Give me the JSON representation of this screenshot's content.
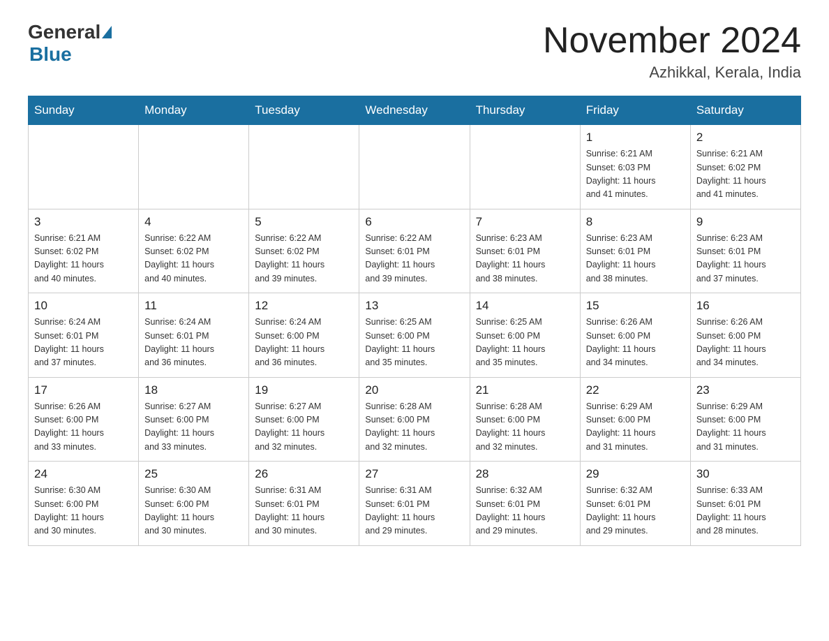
{
  "header": {
    "logo_general": "General",
    "logo_blue": "Blue",
    "month_title": "November 2024",
    "location": "Azhikkal, Kerala, India"
  },
  "weekdays": [
    "Sunday",
    "Monday",
    "Tuesday",
    "Wednesday",
    "Thursday",
    "Friday",
    "Saturday"
  ],
  "weeks": [
    [
      {
        "day": "",
        "info": ""
      },
      {
        "day": "",
        "info": ""
      },
      {
        "day": "",
        "info": ""
      },
      {
        "day": "",
        "info": ""
      },
      {
        "day": "",
        "info": ""
      },
      {
        "day": "1",
        "info": "Sunrise: 6:21 AM\nSunset: 6:03 PM\nDaylight: 11 hours\nand 41 minutes."
      },
      {
        "day": "2",
        "info": "Sunrise: 6:21 AM\nSunset: 6:02 PM\nDaylight: 11 hours\nand 41 minutes."
      }
    ],
    [
      {
        "day": "3",
        "info": "Sunrise: 6:21 AM\nSunset: 6:02 PM\nDaylight: 11 hours\nand 40 minutes."
      },
      {
        "day": "4",
        "info": "Sunrise: 6:22 AM\nSunset: 6:02 PM\nDaylight: 11 hours\nand 40 minutes."
      },
      {
        "day": "5",
        "info": "Sunrise: 6:22 AM\nSunset: 6:02 PM\nDaylight: 11 hours\nand 39 minutes."
      },
      {
        "day": "6",
        "info": "Sunrise: 6:22 AM\nSunset: 6:01 PM\nDaylight: 11 hours\nand 39 minutes."
      },
      {
        "day": "7",
        "info": "Sunrise: 6:23 AM\nSunset: 6:01 PM\nDaylight: 11 hours\nand 38 minutes."
      },
      {
        "day": "8",
        "info": "Sunrise: 6:23 AM\nSunset: 6:01 PM\nDaylight: 11 hours\nand 38 minutes."
      },
      {
        "day": "9",
        "info": "Sunrise: 6:23 AM\nSunset: 6:01 PM\nDaylight: 11 hours\nand 37 minutes."
      }
    ],
    [
      {
        "day": "10",
        "info": "Sunrise: 6:24 AM\nSunset: 6:01 PM\nDaylight: 11 hours\nand 37 minutes."
      },
      {
        "day": "11",
        "info": "Sunrise: 6:24 AM\nSunset: 6:01 PM\nDaylight: 11 hours\nand 36 minutes."
      },
      {
        "day": "12",
        "info": "Sunrise: 6:24 AM\nSunset: 6:00 PM\nDaylight: 11 hours\nand 36 minutes."
      },
      {
        "day": "13",
        "info": "Sunrise: 6:25 AM\nSunset: 6:00 PM\nDaylight: 11 hours\nand 35 minutes."
      },
      {
        "day": "14",
        "info": "Sunrise: 6:25 AM\nSunset: 6:00 PM\nDaylight: 11 hours\nand 35 minutes."
      },
      {
        "day": "15",
        "info": "Sunrise: 6:26 AM\nSunset: 6:00 PM\nDaylight: 11 hours\nand 34 minutes."
      },
      {
        "day": "16",
        "info": "Sunrise: 6:26 AM\nSunset: 6:00 PM\nDaylight: 11 hours\nand 34 minutes."
      }
    ],
    [
      {
        "day": "17",
        "info": "Sunrise: 6:26 AM\nSunset: 6:00 PM\nDaylight: 11 hours\nand 33 minutes."
      },
      {
        "day": "18",
        "info": "Sunrise: 6:27 AM\nSunset: 6:00 PM\nDaylight: 11 hours\nand 33 minutes."
      },
      {
        "day": "19",
        "info": "Sunrise: 6:27 AM\nSunset: 6:00 PM\nDaylight: 11 hours\nand 32 minutes."
      },
      {
        "day": "20",
        "info": "Sunrise: 6:28 AM\nSunset: 6:00 PM\nDaylight: 11 hours\nand 32 minutes."
      },
      {
        "day": "21",
        "info": "Sunrise: 6:28 AM\nSunset: 6:00 PM\nDaylight: 11 hours\nand 32 minutes."
      },
      {
        "day": "22",
        "info": "Sunrise: 6:29 AM\nSunset: 6:00 PM\nDaylight: 11 hours\nand 31 minutes."
      },
      {
        "day": "23",
        "info": "Sunrise: 6:29 AM\nSunset: 6:00 PM\nDaylight: 11 hours\nand 31 minutes."
      }
    ],
    [
      {
        "day": "24",
        "info": "Sunrise: 6:30 AM\nSunset: 6:00 PM\nDaylight: 11 hours\nand 30 minutes."
      },
      {
        "day": "25",
        "info": "Sunrise: 6:30 AM\nSunset: 6:00 PM\nDaylight: 11 hours\nand 30 minutes."
      },
      {
        "day": "26",
        "info": "Sunrise: 6:31 AM\nSunset: 6:01 PM\nDaylight: 11 hours\nand 30 minutes."
      },
      {
        "day": "27",
        "info": "Sunrise: 6:31 AM\nSunset: 6:01 PM\nDaylight: 11 hours\nand 29 minutes."
      },
      {
        "day": "28",
        "info": "Sunrise: 6:32 AM\nSunset: 6:01 PM\nDaylight: 11 hours\nand 29 minutes."
      },
      {
        "day": "29",
        "info": "Sunrise: 6:32 AM\nSunset: 6:01 PM\nDaylight: 11 hours\nand 29 minutes."
      },
      {
        "day": "30",
        "info": "Sunrise: 6:33 AM\nSunset: 6:01 PM\nDaylight: 11 hours\nand 28 minutes."
      }
    ]
  ]
}
